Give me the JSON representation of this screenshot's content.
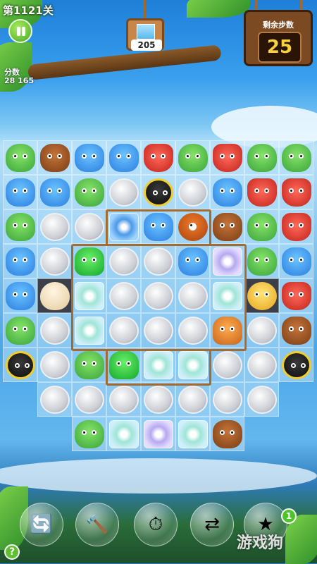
{
  "hud": {
    "level_label": "第1121关",
    "score_label": "分数",
    "score_value": "28 165",
    "target_count": "205",
    "moves_title": "剩余步数",
    "moves_value": "25"
  },
  "boosters": [
    {
      "name": "shuffle-board",
      "icon": "board-swap-icon"
    },
    {
      "name": "hammer",
      "icon": "hammer-icon"
    },
    {
      "name": "undo-clock",
      "icon": "clock-arrow-icon"
    },
    {
      "name": "swap-animals",
      "icon": "animals-swap-icon"
    },
    {
      "name": "star-bomb",
      "icon": "star-icon",
      "count": "1"
    }
  ],
  "watermark": "游戏狗",
  "help_label": "?",
  "board": {
    "rows": [
      [
        "frog",
        "bear",
        "hippo",
        "hippo",
        "fox",
        "frog",
        "fox",
        "frog",
        "frog"
      ],
      [
        "hippo",
        "hippo",
        "frog",
        "coin",
        "robot",
        "coin",
        "hippo",
        "fox",
        "fox"
      ],
      [
        "frog",
        "coin",
        "coin",
        "flower-blue",
        "hippo",
        "monster",
        "bear",
        "frog",
        "fox"
      ],
      [
        "hippo",
        "coin",
        "jelly",
        "coin",
        "coin",
        "hippo",
        "flower-purple",
        "frog",
        "hippo"
      ],
      [
        "hippo",
        "egg",
        "flower",
        "coin",
        "coin",
        "coin",
        "flower",
        "chick",
        "fox"
      ],
      [
        "frog",
        "coin",
        "flower",
        "coin",
        "coin",
        "coin",
        "jelly-orange",
        "coin",
        "bear"
      ],
      [
        "robot",
        "coin",
        "frog",
        "jelly",
        "flower",
        "flower",
        "coin",
        "coin",
        "robot"
      ],
      [
        null,
        "coin",
        "coin",
        "coin",
        "coin",
        "coin",
        "coin",
        "coin",
        null
      ],
      [
        null,
        null,
        "frog",
        "flower",
        "flower-purple",
        "flower",
        "bear",
        null,
        null
      ]
    ]
  }
}
